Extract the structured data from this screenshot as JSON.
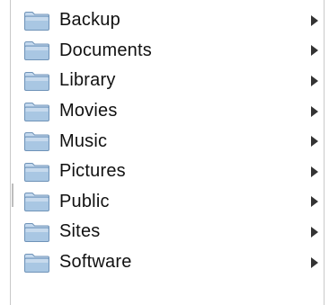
{
  "browser_column": {
    "items": [
      {
        "label": "Backup",
        "icon": "folder-icon"
      },
      {
        "label": "Documents",
        "icon": "folder-icon"
      },
      {
        "label": "Library",
        "icon": "folder-icon"
      },
      {
        "label": "Movies",
        "icon": "folder-icon"
      },
      {
        "label": "Music",
        "icon": "folder-icon"
      },
      {
        "label": "Pictures",
        "icon": "folder-icon"
      },
      {
        "label": "Public",
        "icon": "folder-icon"
      },
      {
        "label": "Sites",
        "icon": "folder-icon"
      },
      {
        "label": "Software",
        "icon": "folder-icon"
      }
    ],
    "colors": {
      "folder_fill": "#a9c7e3",
      "folder_tab": "#c4d9ee",
      "folder_stroke": "#6f93b8",
      "arrow": "#333333",
      "text": "#111111"
    }
  }
}
